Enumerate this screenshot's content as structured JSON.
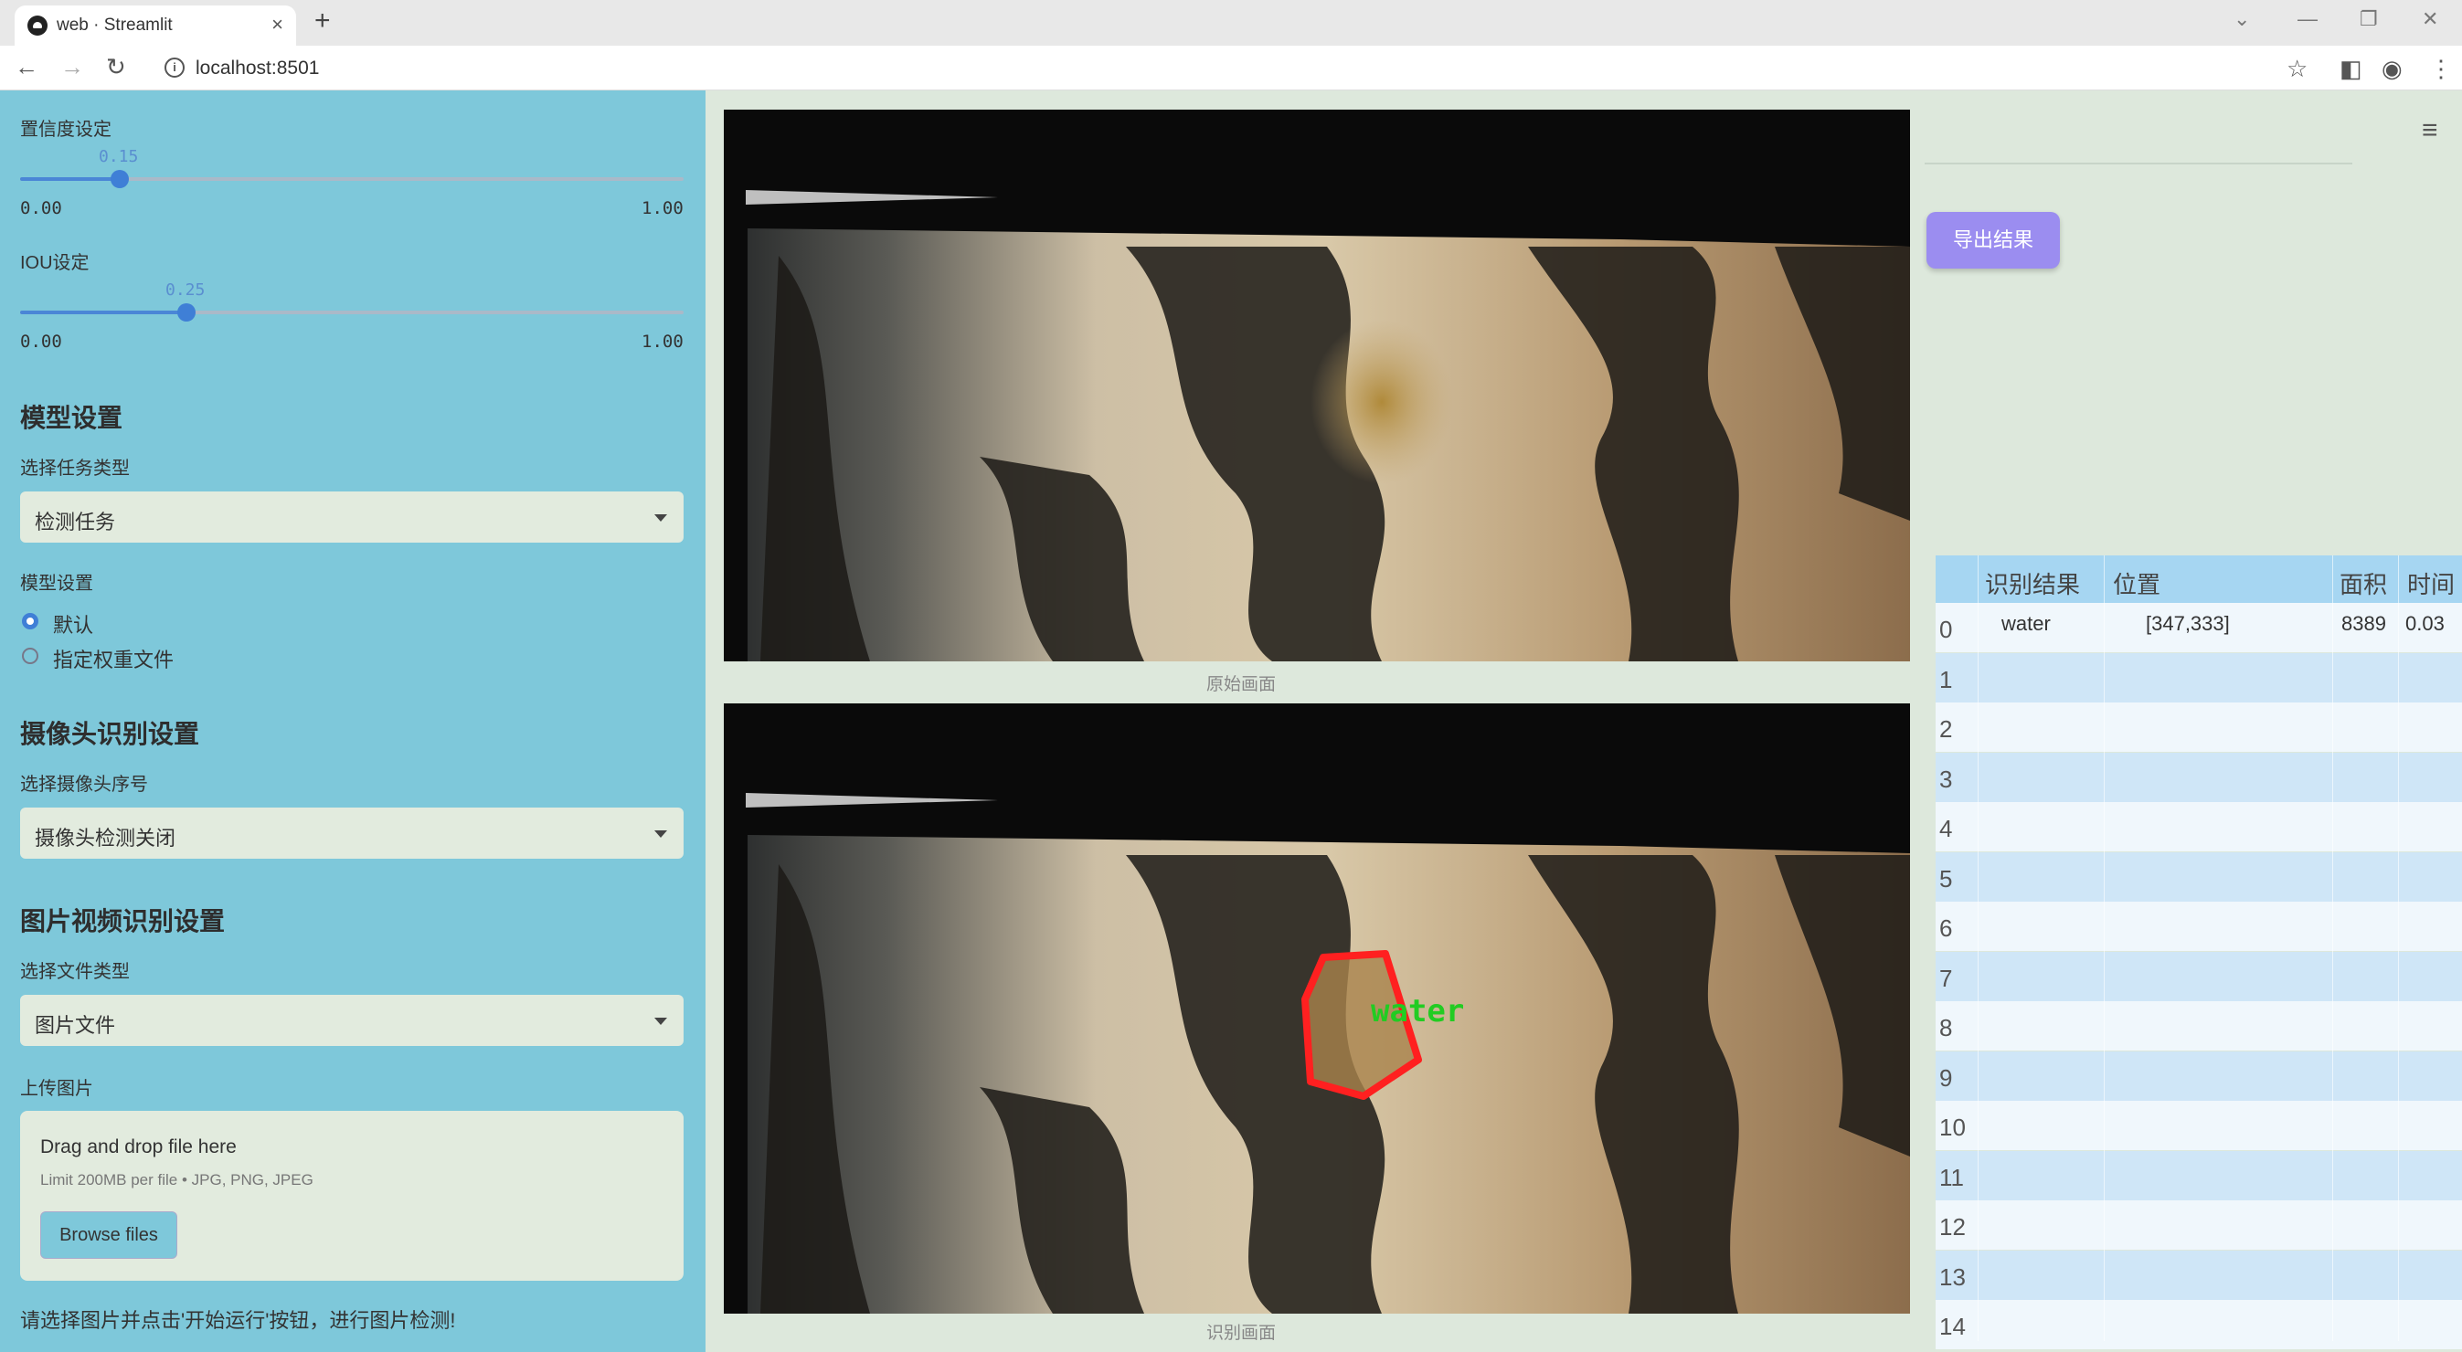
{
  "browser": {
    "tab_title": "web · Streamlit",
    "url": "localhost:8501"
  },
  "sidebar": {
    "confidence": {
      "label": "置信度设定",
      "value": "0.15",
      "min": "0.00",
      "max": "1.00",
      "fraction": 0.15
    },
    "iou": {
      "label": "IOU设定",
      "value": "0.25",
      "min": "0.00",
      "max": "1.00",
      "fraction": 0.25
    },
    "model_section": "模型设置",
    "task_type_label": "选择任务类型",
    "task_type_value": "检测任务",
    "model_label": "模型设置",
    "model_options": [
      "默认",
      "指定权重文件"
    ],
    "camera_section": "摄像头识别设置",
    "camera_label": "选择摄像头序号",
    "camera_value": "摄像头检测关闭",
    "media_section": "图片视频识别设置",
    "file_type_label": "选择文件类型",
    "file_type_value": "图片文件",
    "upload_label": "上传图片",
    "upload": {
      "drag_text": "Drag and drop file here",
      "limit_text": "Limit 200MB per file • JPG, PNG, JPEG",
      "browse_button": "Browse files"
    },
    "hint": "请选择图片并点击'开始运行'按钮，进行图片检测!"
  },
  "main": {
    "original_caption": "原始画面",
    "detected_caption": "识别画面",
    "detection_label": "water",
    "export_button": "导出结果"
  },
  "table": {
    "headers": [
      "识别结果",
      "位置",
      "面积",
      "时间"
    ],
    "rows": [
      {
        "index": "0",
        "result": "water",
        "position": "[347,333]",
        "area": "8389",
        "time": "0.03"
      },
      {
        "index": "1"
      },
      {
        "index": "2"
      },
      {
        "index": "3"
      },
      {
        "index": "4"
      },
      {
        "index": "5"
      },
      {
        "index": "6"
      },
      {
        "index": "7"
      },
      {
        "index": "8"
      },
      {
        "index": "9"
      },
      {
        "index": "10"
      },
      {
        "index": "11"
      },
      {
        "index": "12"
      },
      {
        "index": "13"
      },
      {
        "index": "14"
      }
    ]
  },
  "colors": {
    "sidebar_bg": "#7ec8da",
    "main_bg": "#dde8dc",
    "accent": "#3f7fd6",
    "export_button": "#9b8df0",
    "detection_box": "#ff2020",
    "detection_text": "#22cc22"
  },
  "icons": [
    "back-icon",
    "forward-icon",
    "reload-icon",
    "info-icon",
    "star-icon",
    "sidebar-toggle-icon",
    "profile-icon",
    "menu-dots-icon",
    "hamburger-menu-icon",
    "caret-down-icon"
  ]
}
